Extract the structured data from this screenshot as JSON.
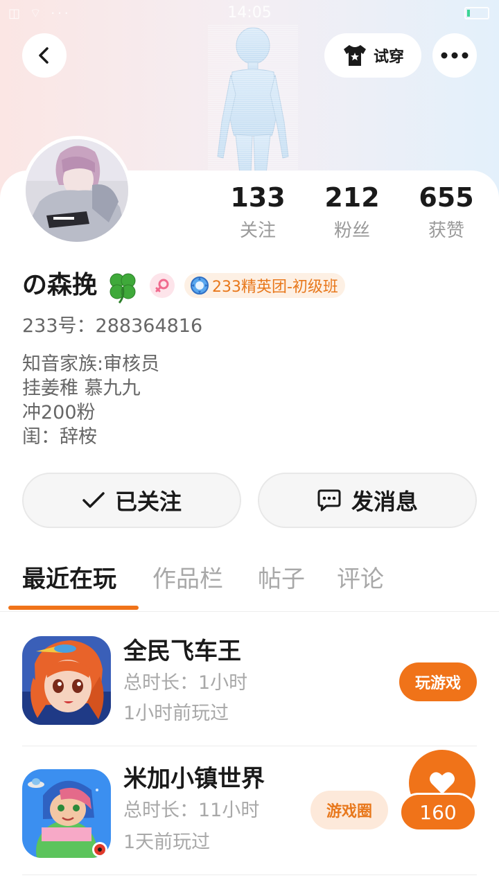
{
  "status_bar": {
    "time": "14:05",
    "left_icons": "◫ ⌔ ···"
  },
  "header": {
    "back_icon": "chevron-left-icon",
    "try_on_label": "试穿",
    "more_icon": "more-dots-icon"
  },
  "profile": {
    "stats": [
      {
        "value": "133",
        "label": "关注"
      },
      {
        "value": "212",
        "label": "粉丝"
      },
      {
        "value": "655",
        "label": "获赞"
      }
    ],
    "nickname": "の森挽",
    "gender": "female",
    "level_badge": "233精英团-初级班",
    "id_label": "233号：",
    "id_value": "288364816",
    "bio_lines": [
      "知音家族:审核员",
      "挂姜稚  慕九九",
      "冲200粉",
      "闺：辞桉"
    ]
  },
  "actions": {
    "follow_label": "已关注",
    "message_label": "发消息"
  },
  "tabs": [
    {
      "label": "最近在玩",
      "active": true
    },
    {
      "label": "作品栏",
      "active": false
    },
    {
      "label": "帖子",
      "active": false
    },
    {
      "label": "评论",
      "active": false
    }
  ],
  "games": [
    {
      "name": "全民飞车王",
      "duration": "总时长：1小时",
      "last_played": "1小时前玩过",
      "action_label": "玩游戏"
    },
    {
      "name": "米加小镇世界",
      "duration": "总时长：11小时",
      "last_played": "1天前玩过",
      "action_label": "游戏圈"
    }
  ],
  "like_fab": {
    "count": "160"
  },
  "colors": {
    "accent": "#f07319",
    "accent_light": "#fde9da",
    "text_primary": "#1a1a1a",
    "text_secondary": "#9a9a9a"
  }
}
